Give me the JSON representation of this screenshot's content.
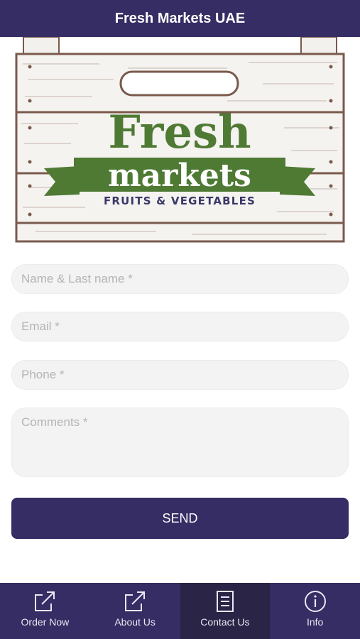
{
  "header": {
    "title": "Fresh Markets UAE"
  },
  "logo": {
    "word1": "Fresh",
    "word2": "markets",
    "tagline": "FRUITS & VEGETABLES"
  },
  "form": {
    "name_placeholder": "Name & Last name *",
    "email_placeholder": "Email *",
    "phone_placeholder": "Phone *",
    "comments_placeholder": "Comments *",
    "send_label": "SEND"
  },
  "tabs": [
    {
      "label": "Order Now",
      "icon": "external-link-icon"
    },
    {
      "label": "About Us",
      "icon": "external-link-icon"
    },
    {
      "label": "Contact Us",
      "icon": "document-icon",
      "active": true
    },
    {
      "label": "Info",
      "icon": "info-icon"
    }
  ],
  "colors": {
    "brand": "#352d63",
    "logo_green": "#4f7a34",
    "logo_navy": "#3a3868",
    "wood": "#7a5a4c"
  }
}
